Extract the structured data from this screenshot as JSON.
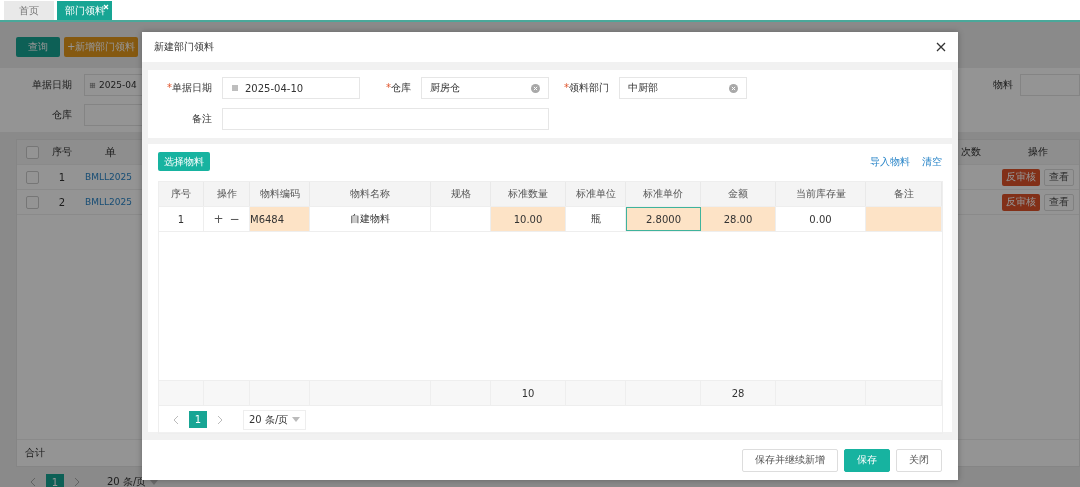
{
  "tabs": [
    {
      "label": "首页",
      "selected": false,
      "closable": false
    },
    {
      "label": "部门领料",
      "selected": true,
      "closable": true
    }
  ],
  "page": {
    "toolbar": [
      {
        "label": "查询",
        "kind": "primary"
      },
      {
        "label": "+新增部门领料",
        "kind": "warning"
      }
    ],
    "filters_left": [
      {
        "label": "单据日期",
        "value": "2025-04",
        "kind": "date"
      },
      {
        "label": "仓库",
        "kind": "text"
      }
    ],
    "filters_right": [
      {
        "label": "物料",
        "kind": "text"
      }
    ],
    "table": {
      "header_checked": false,
      "columns_left": [
        "序号",
        "单"
      ],
      "columns_right": [
        "次数",
        "操作"
      ],
      "rows": [
        {
          "checked": false,
          "index": "1",
          "code": "BMLL2025",
          "actions": [
            {
              "label": "反审核",
              "kind": "danger"
            },
            {
              "label": "查看",
              "kind": "default"
            }
          ]
        },
        {
          "checked": false,
          "index": "2",
          "code": "BMLL2025",
          "actions": [
            {
              "label": "反审核",
              "kind": "danger"
            },
            {
              "label": "查看",
              "kind": "default"
            }
          ]
        }
      ],
      "summary_label": "合计"
    },
    "pagination": {
      "page": "1",
      "page_size": "20 条/页"
    }
  },
  "dialog": {
    "title": "新建部门领料",
    "fields": [
      {
        "required_mark": "*",
        "label": "单据日期",
        "value": "2025-04-10",
        "kind": "date"
      },
      {
        "required_mark": "*",
        "label": "仓库",
        "value": "厨房仓",
        "kind": "select"
      },
      {
        "required_mark": "*",
        "label": "领料部门",
        "value": "中厨部",
        "kind": "select"
      }
    ],
    "remark": {
      "label": "备注"
    },
    "select_button": "选择物料",
    "links": [
      "导入物料",
      "清空"
    ],
    "columns": [
      {
        "label": "序号"
      },
      {
        "label": "操作"
      },
      {
        "label": "物料编码"
      },
      {
        "label": "物料名称"
      },
      {
        "label": "规格"
      },
      {
        "label": "标准数量",
        "total": "10"
      },
      {
        "label": "标准单位"
      },
      {
        "label": "标准单价"
      },
      {
        "label": "金额",
        "total": "28"
      },
      {
        "label": "当前库存量"
      },
      {
        "label": "备注"
      }
    ],
    "rows": [
      {
        "cells": [
          {
            "kind": "text",
            "text": "1",
            "highlighted": false,
            "focused": false
          },
          {
            "kind": "ops",
            "buttons": [
              "+",
              "−"
            ],
            "highlighted": false,
            "focused": false
          },
          {
            "kind": "text",
            "text": "M6484",
            "highlighted": true,
            "focused": false
          },
          {
            "kind": "text",
            "text": "自建物料",
            "highlighted": false,
            "focused": false
          },
          {
            "kind": "text",
            "highlighted": false,
            "focused": false
          },
          {
            "kind": "text",
            "text": "10.00",
            "highlighted": true,
            "focused": false
          },
          {
            "kind": "text",
            "text": "瓶",
            "highlighted": false,
            "focused": false
          },
          {
            "kind": "text",
            "text": "2.8000",
            "highlighted": true,
            "focused": true
          },
          {
            "kind": "text",
            "text": "28.00",
            "highlighted": true,
            "focused": false
          },
          {
            "kind": "text",
            "text": "0.00",
            "highlighted": false,
            "focused": false
          },
          {
            "kind": "text",
            "highlighted": true,
            "focused": false
          }
        ]
      }
    ],
    "pagination": {
      "page": "1",
      "page_size": "20 条/页"
    },
    "footer_buttons": [
      {
        "label": "保存并继续新增",
        "kind": "default"
      },
      {
        "label": "保存",
        "kind": "primary"
      },
      {
        "label": "关闭",
        "kind": "default"
      }
    ]
  }
}
